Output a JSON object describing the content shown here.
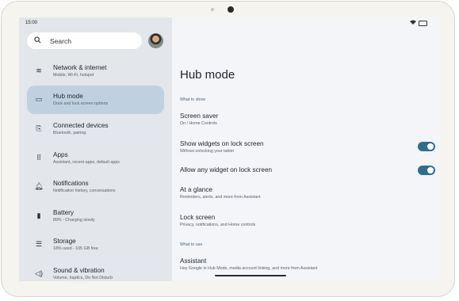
{
  "status": {
    "time": "15:00"
  },
  "search": {
    "placeholder": "Search"
  },
  "sidebar": {
    "items": [
      {
        "icon": "wifi-icon",
        "glyph": "≋",
        "label": "Network & internet",
        "sub": "Mobile, Wi-Fi, hotspot"
      },
      {
        "icon": "hub-icon",
        "glyph": "▭",
        "label": "Hub mode",
        "sub": "Dock and lock screen options",
        "active": true
      },
      {
        "icon": "devices-icon",
        "glyph": "⎘",
        "label": "Connected devices",
        "sub": "Bluetooth, pairing"
      },
      {
        "icon": "apps-icon",
        "glyph": "⠿",
        "label": "Apps",
        "sub": "Assistant, recent apps, default apps"
      },
      {
        "icon": "bell-icon",
        "glyph": "🔔︎",
        "label": "Notifications",
        "sub": "Notification history, conversations"
      },
      {
        "icon": "battery-icon",
        "glyph": "▮",
        "label": "Battery",
        "sub": "89% - Charging slowly"
      },
      {
        "icon": "storage-icon",
        "glyph": "☰",
        "label": "Storage",
        "sub": "18% used - 105 GB free"
      },
      {
        "icon": "sound-icon",
        "glyph": "◁)",
        "label": "Sound & vibration",
        "sub": "Volume, haptics, Do Not Disturb"
      }
    ]
  },
  "main": {
    "title": "Hub mode",
    "section_show": "What to show",
    "screen_saver": {
      "label": "Screen saver",
      "sub": "On / Home Controls"
    },
    "widgets_lock": {
      "label": "Show widgets on lock screen",
      "sub": "Without unlocking your tablet",
      "on": true
    },
    "any_widget": {
      "label": "Allow any widget on lock screen",
      "on": true
    },
    "at_a_glance": {
      "label": "At a glance",
      "sub": "Reminders, alerts, and more from Assistant"
    },
    "lock_screen": {
      "label": "Lock screen",
      "sub": "Privacy, notifications, and Home controls"
    },
    "section_use": "What to use",
    "assistant": {
      "label": "Assistant",
      "sub": "Hey Google in Hub Mode, media account linking, and more from Assistant"
    }
  }
}
